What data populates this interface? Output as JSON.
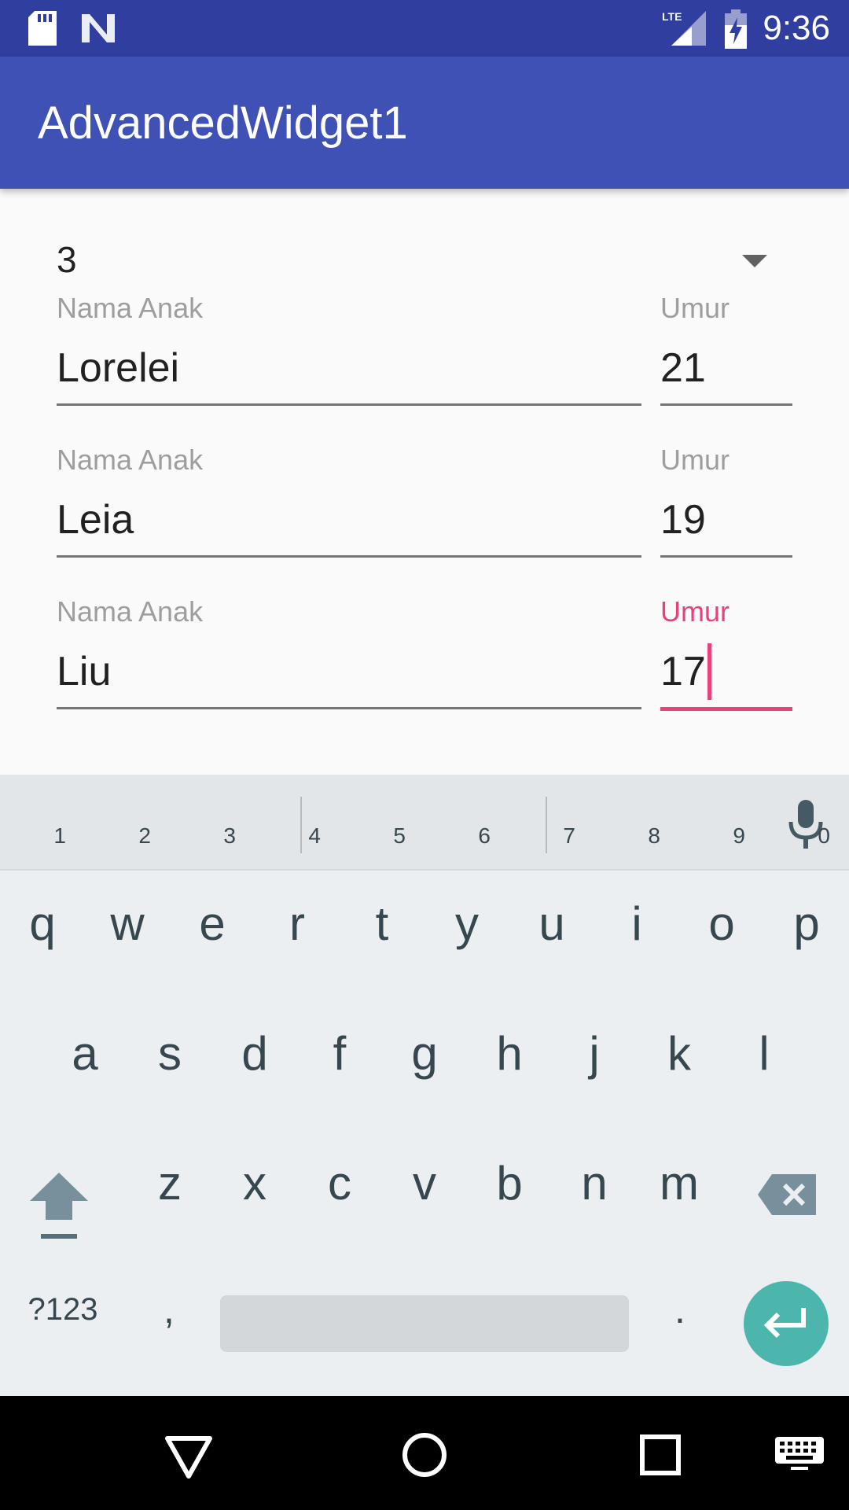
{
  "status_bar": {
    "time": "9:36",
    "icons": [
      "sd-card-icon",
      "n-logo-icon",
      "lte-signal-icon",
      "battery-charging-icon"
    ],
    "color": "#303f9f"
  },
  "app_bar": {
    "title": "AdvancedWidget1",
    "color": "#3f51b5"
  },
  "spinner": {
    "selected": "3"
  },
  "children": [
    {
      "name_label": "Nama Anak",
      "name": "Lorelei",
      "age_label": "Umur",
      "age": "21",
      "focused": false
    },
    {
      "name_label": "Nama Anak",
      "name": "Leia",
      "age_label": "Umur",
      "age": "19",
      "focused": false
    },
    {
      "name_label": "Nama Anak",
      "name": "Liu",
      "age_label": "Umur",
      "age": "17",
      "focused": true
    }
  ],
  "accent_color": "#ec407a",
  "keyboard": {
    "row1": [
      {
        "key": "q",
        "hint": "1"
      },
      {
        "key": "w",
        "hint": "2"
      },
      {
        "key": "e",
        "hint": "3"
      },
      {
        "key": "r",
        "hint": "4"
      },
      {
        "key": "t",
        "hint": "5"
      },
      {
        "key": "y",
        "hint": "6"
      },
      {
        "key": "u",
        "hint": "7"
      },
      {
        "key": "i",
        "hint": "8"
      },
      {
        "key": "o",
        "hint": "9"
      },
      {
        "key": "p",
        "hint": "0"
      }
    ],
    "row2": [
      "a",
      "s",
      "d",
      "f",
      "g",
      "h",
      "j",
      "k",
      "l"
    ],
    "row3": [
      "z",
      "x",
      "c",
      "v",
      "b",
      "n",
      "m"
    ],
    "symbols_label": "?123",
    "comma_label": ",",
    "period_label": ".",
    "enter_color": "#4db6ac"
  },
  "nav_bar": {
    "buttons": [
      "back-icon",
      "home-icon",
      "recents-icon",
      "keyboard-switch-icon"
    ]
  }
}
